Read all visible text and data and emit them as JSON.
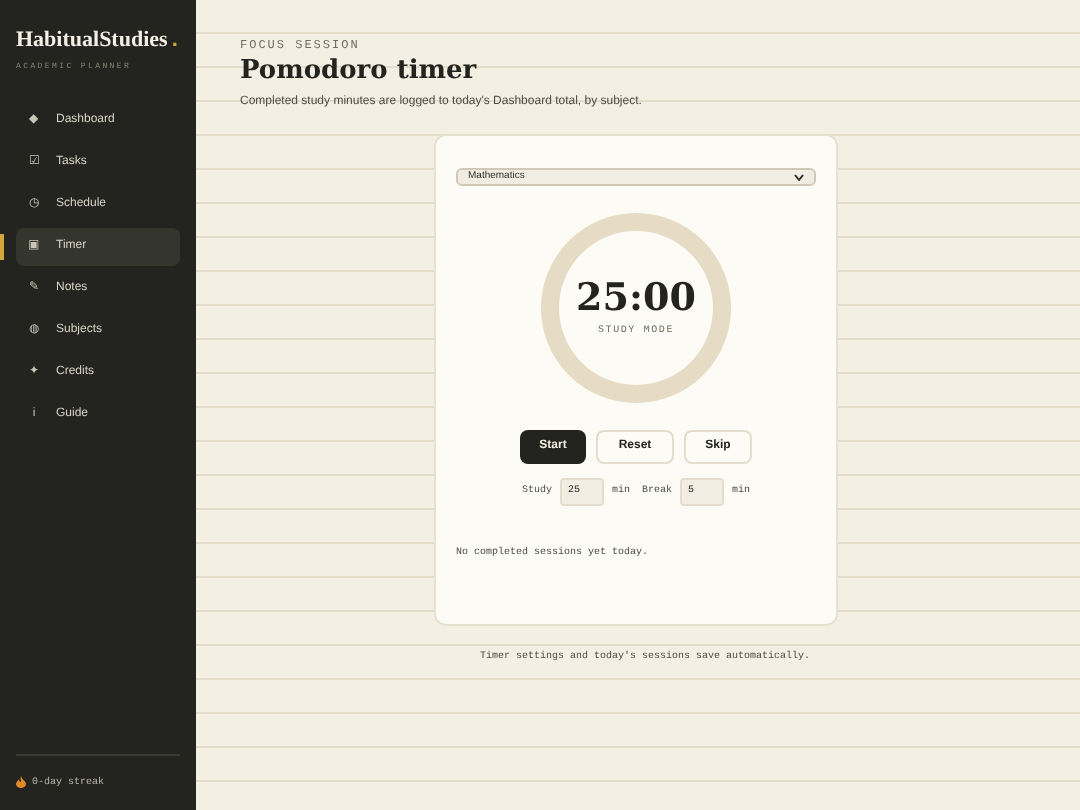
{
  "sidebar": {
    "brand": "HabitualStudies",
    "brand_dot": ".",
    "tagline": "ACADEMIC PLANNER",
    "items": [
      {
        "icon": "◆",
        "label": "Dashboard",
        "selected": false
      },
      {
        "icon": "☑",
        "label": "Tasks",
        "selected": false
      },
      {
        "icon": "◷",
        "label": "Schedule",
        "selected": false
      },
      {
        "icon": "▣",
        "label": "Timer",
        "selected": true
      },
      {
        "icon": "✎",
        "label": "Notes",
        "selected": false
      },
      {
        "icon": "◍",
        "label": "Subjects",
        "selected": false
      },
      {
        "icon": "✦",
        "label": "Credits",
        "selected": false
      },
      {
        "icon": "i",
        "label": "Guide",
        "selected": false
      }
    ],
    "streak": "0-day streak"
  },
  "header": {
    "eyebrow": "FOCUS SESSION",
    "title": "Pomodoro timer",
    "subtitle": "Completed study minutes are logged to today's Dashboard total, by subject."
  },
  "timer": {
    "subject": "Mathematics",
    "time": "25:00",
    "mode": "STUDY MODE",
    "level": 0,
    "buttons": [
      {
        "label": "Start",
        "primary": true
      },
      {
        "label": "Reset",
        "primary": false
      },
      {
        "label": "Skip",
        "primary": false
      }
    ],
    "study_label": "Study",
    "study_value": "25",
    "study_unit": "min",
    "break_label": "Break",
    "break_value": "5",
    "break_unit": "min",
    "sessions_note": "No completed sessions yet today."
  },
  "footer": "Timer settings and today's sessions save automatically."
}
